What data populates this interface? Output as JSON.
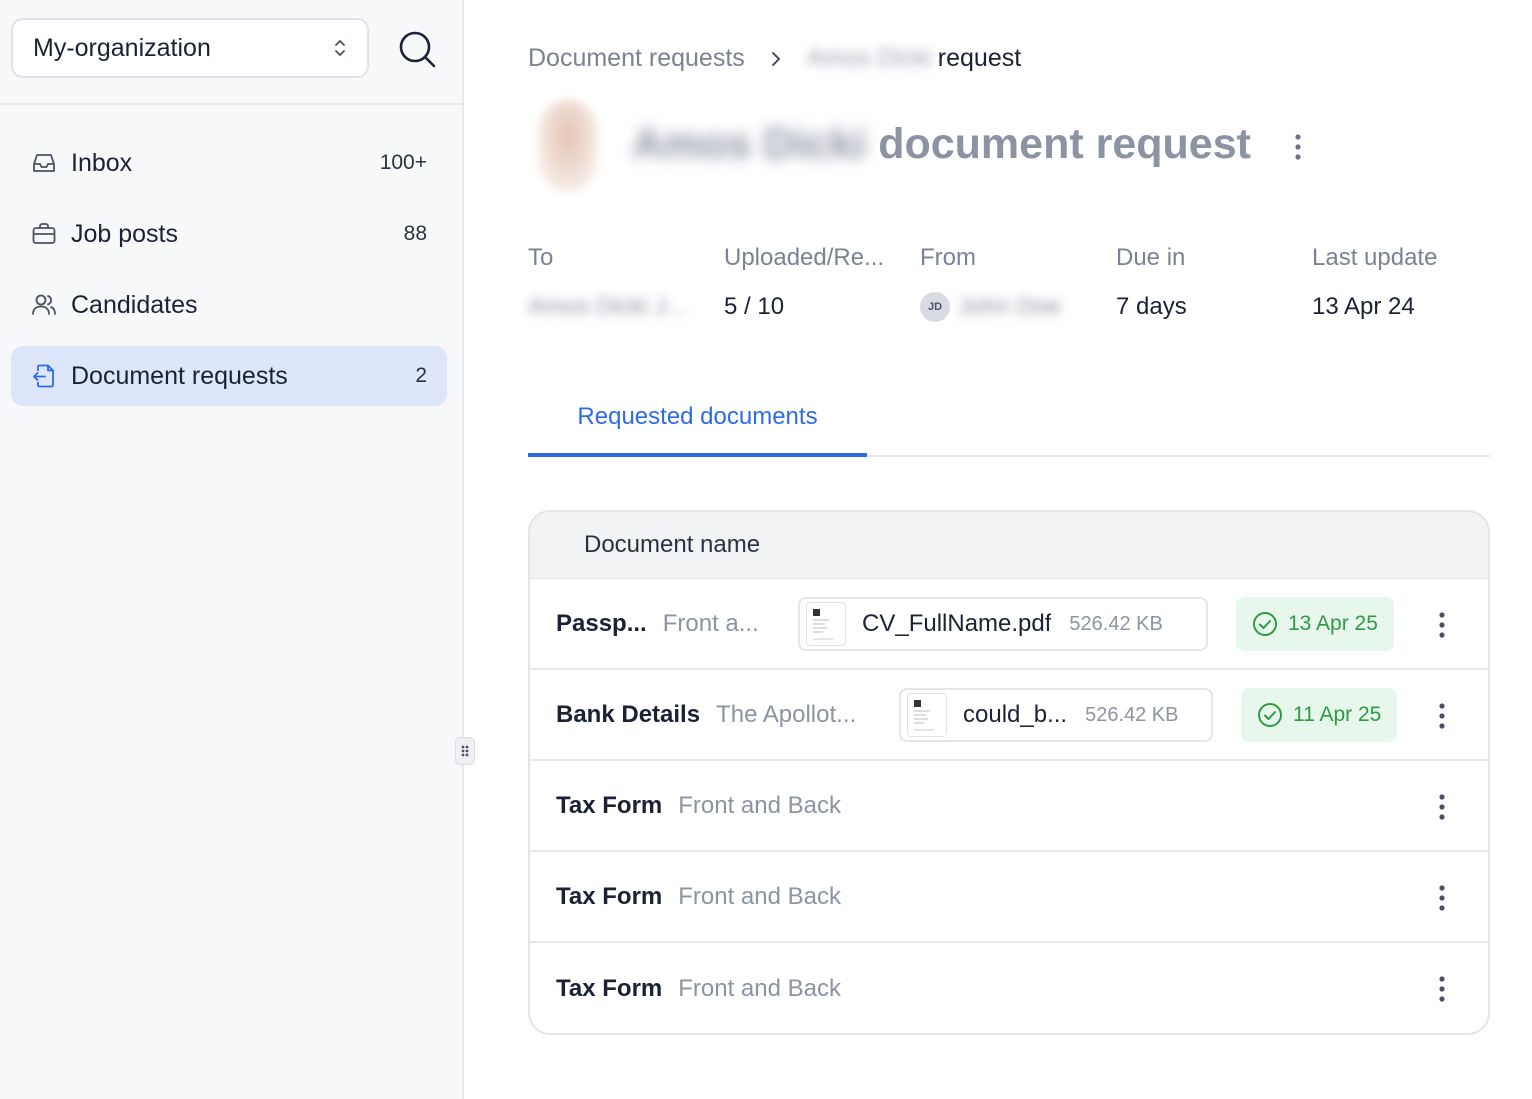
{
  "sidebar": {
    "org_name": "My-organization",
    "items": [
      {
        "label": "Inbox",
        "count": "100+",
        "icon": "inbox-icon"
      },
      {
        "label": "Job posts",
        "count": "88",
        "icon": "briefcase-icon"
      },
      {
        "label": "Candidates",
        "count": "",
        "icon": "users-icon"
      },
      {
        "label": "Document requests",
        "count": "2",
        "icon": "document-request-icon",
        "active": true
      }
    ]
  },
  "breadcrumb": {
    "parent": "Document requests",
    "current_name": "Amos Dicki",
    "current_suffix": "request"
  },
  "header": {
    "name": "Amos Dicki",
    "title_suffix": "document request"
  },
  "meta": {
    "to_label": "To",
    "to_value": "Amos Dicki J...",
    "uploaded_label": "Uploaded/Re...",
    "uploaded_value": "5 / 10",
    "from_label": "From",
    "from_initials": "JD",
    "from_name": "John Doe",
    "due_label": "Due in",
    "due_value": "7 days",
    "last_update_label": "Last update",
    "last_update_value": "13 Apr 24"
  },
  "tabs": [
    {
      "label": "Requested documents",
      "active": true
    }
  ],
  "table": {
    "header": "Document name",
    "rows": [
      {
        "name": "Passp...",
        "desc": "Front a...",
        "file_name": "CV_FullName.pdf",
        "file_size": "526.42 KB",
        "status_date": "13 Apr 25"
      },
      {
        "name": "Bank Details",
        "desc": "The Apollot...",
        "file_name": "could_b...",
        "file_size": "526.42 KB",
        "status_date": "11 Apr 25"
      },
      {
        "name": "Tax Form",
        "desc": "Front and Back"
      },
      {
        "name": "Tax Form",
        "desc": "Front and Back"
      },
      {
        "name": "Tax Form",
        "desc": "Front and Back"
      }
    ]
  },
  "colors": {
    "accent": "#2e6be6",
    "active_nav_bg": "#dde6fb",
    "status_green": "#2f9a46",
    "status_bg": "#e8f7ec"
  }
}
